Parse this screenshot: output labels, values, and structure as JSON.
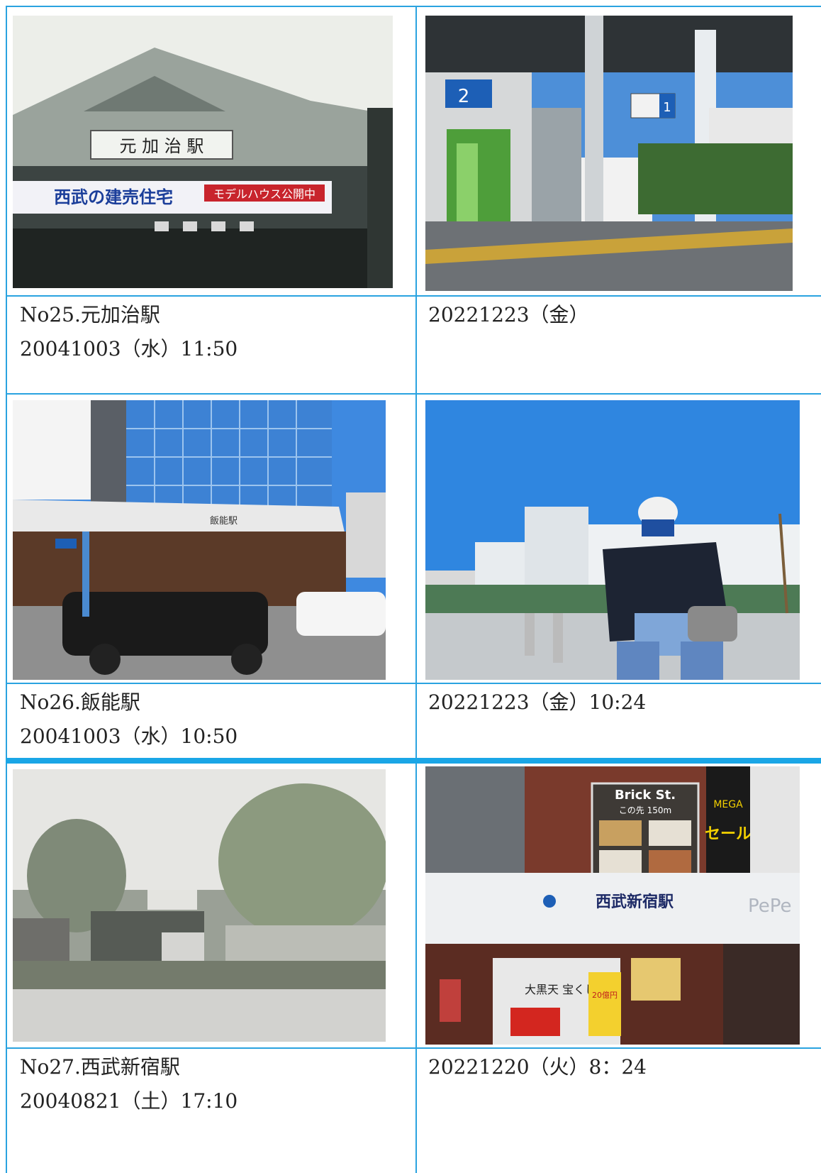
{
  "rows": [
    {
      "left_caption": {
        "line1": "No25.元加治駅",
        "line2": "20041003（水）11:50"
      },
      "right_caption": {
        "line1": "20221223（金）"
      },
      "left_photo": {
        "sign_text": "元 加 治 駅",
        "banner_text": "西武の建売住宅",
        "banner_tag": "モデルハウス公開中"
      },
      "right_photo": {
        "platform_number": "2",
        "platform_number_right": "1"
      }
    },
    {
      "left_caption": {
        "line1": "No26.飯能駅",
        "line2": "20041003（水）10:50"
      },
      "right_caption": {
        "line1": "20221223（金）10:24"
      },
      "left_photo": {
        "station_label": "飯能駅"
      },
      "right_photo": {}
    },
    {
      "left_caption": {
        "line1": "No27.西武新宿駅",
        "line2": "20040821（土）17:10"
      },
      "right_caption": {
        "line1": "20221220（火）8：24"
      },
      "left_photo": {},
      "right_photo": {
        "brick_title": "Brick St.",
        "brick_sub": "この先 150m",
        "mega": "MEGA",
        "sale": "セール",
        "station_sign": "西武新宿駅",
        "pepe": "PePe",
        "lottery": "大黒天 宝くじ",
        "yen": "20億円"
      }
    }
  ],
  "colors": {
    "border": "#2aa3e0",
    "separator": "#1aa6e6"
  }
}
